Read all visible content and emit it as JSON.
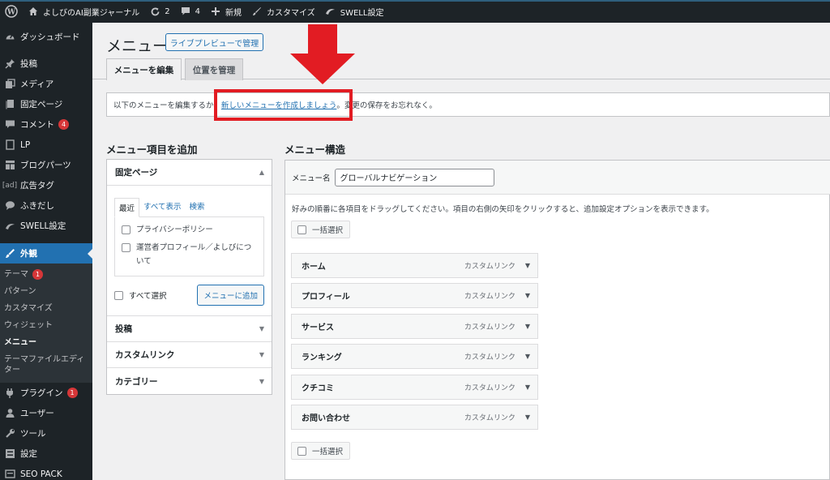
{
  "admin_bar": {
    "site_name": "よしびのAI副業ジャーナル",
    "updates_count": "2",
    "comments_count": "4",
    "new_label": "新規",
    "customize_label": "カスタマイズ",
    "swell_label": "SWELL設定"
  },
  "sidebar": {
    "items": [
      {
        "label": "ダッシュボード",
        "icon": "dashboard-icon"
      },
      {
        "label": "投稿",
        "icon": "pin-icon"
      },
      {
        "label": "メディア",
        "icon": "media-icon"
      },
      {
        "label": "固定ページ",
        "icon": "page-icon"
      },
      {
        "label": "コメント",
        "icon": "comment-icon",
        "badge": "4"
      },
      {
        "label": "LP",
        "icon": "lp-icon"
      },
      {
        "label": "ブログパーツ",
        "icon": "blog-parts-icon"
      },
      {
        "label": "広告タグ",
        "icon": "ad-icon",
        "icon_text": "[ad]"
      },
      {
        "label": "ふきだし",
        "icon": "balloon-icon"
      },
      {
        "label": "SWELL設定",
        "icon": "swell-icon"
      }
    ],
    "current": {
      "label": "外観",
      "icon": "appearance-icon"
    },
    "submenu": [
      {
        "label": "テーマ",
        "badge": "1"
      },
      {
        "label": "パターン"
      },
      {
        "label": "カスタマイズ"
      },
      {
        "label": "ウィジェット"
      },
      {
        "label": "メニュー"
      },
      {
        "label": "テーマファイルエディター"
      }
    ],
    "after": [
      {
        "label": "プラグイン",
        "icon": "plugin-icon",
        "badge": "1"
      },
      {
        "label": "ユーザー",
        "icon": "user-icon"
      },
      {
        "label": "ツール",
        "icon": "tool-icon"
      },
      {
        "label": "設定",
        "icon": "settings-icon"
      },
      {
        "label": "SEO PACK",
        "icon": "seo-icon"
      }
    ]
  },
  "page": {
    "title": "メニュー",
    "live_preview_button": "ライブプレビューで管理",
    "tabs": [
      "メニューを編集",
      "位置を管理"
    ],
    "notice_before": "以下のメニューを編集するか、",
    "notice_link": "新しいメニューを作成しましょう",
    "notice_after": "。変更の保存をお忘れなく。"
  },
  "add_items": {
    "heading": "メニュー項目を追加",
    "sections": [
      "固定ページ",
      "投稿",
      "カスタムリンク",
      "カテゴリー"
    ],
    "inner_tabs": [
      "最近",
      "すべて表示",
      "検索"
    ],
    "pages": [
      "プライバシーポリシー",
      "運営者プロフィール／よしびについて"
    ],
    "select_all": "すべて選択",
    "add_button": "メニューに追加"
  },
  "structure": {
    "heading": "メニュー構造",
    "name_label": "メニュー名",
    "name_value": "グローバルナビゲーション",
    "instructions": "好みの順番に各項目をドラッグしてください。項目の右側の矢印をクリックすると、追加設定オプションを表示できます。",
    "bulk_select": "一括選択",
    "items": [
      {
        "label": "ホーム",
        "type": "カスタムリンク"
      },
      {
        "label": "プロフィール",
        "type": "カスタムリンク"
      },
      {
        "label": "サービス",
        "type": "カスタムリンク"
      },
      {
        "label": "ランキング",
        "type": "カスタムリンク"
      },
      {
        "label": "クチコミ",
        "type": "カスタムリンク"
      },
      {
        "label": "お問い合わせ",
        "type": "カスタムリンク"
      }
    ]
  },
  "colors": {
    "highlight": "#e21c23",
    "accent": "#2271b1",
    "admin_bg": "#1d2327"
  }
}
